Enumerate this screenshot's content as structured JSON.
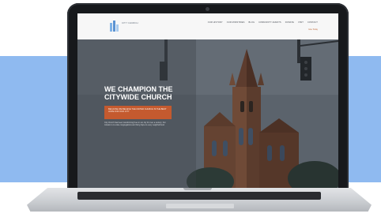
{
  "site": {
    "logo_text": "CITY CHURCH",
    "nav": [
      "OUR HISTORY",
      "OUR MINISTRIES",
      "BLOG",
      "COMMUNITY EVENTS",
      "DONATE",
      "VISIT",
      "CONTACT"
    ],
    "header_sub": "Give Today"
  },
  "hero": {
    "title": "WE CHAMPION THE CITYWIDE CHURCH",
    "cta_text": "BECAUSE WE BELIEVE THE UNITED CHURCH IS THE BEST HOPE FOR OUR CITY",
    "paragraph": "City Church has been transforming lives in our city for over a century. Our mission is to unite congregations and bring hope to every neighborhood."
  },
  "colors": {
    "accent": "#c45a2f",
    "backdrop": "#8fbaf0"
  }
}
